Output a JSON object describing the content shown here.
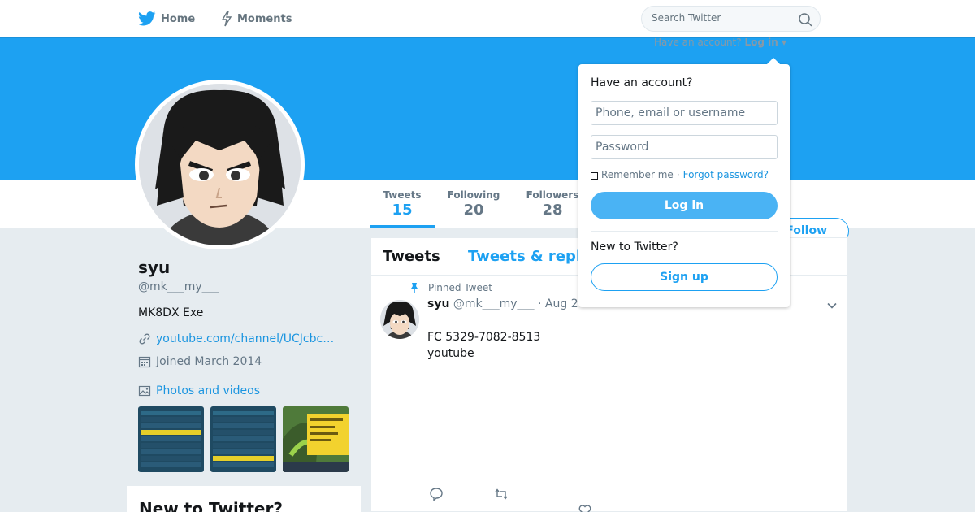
{
  "nav": {
    "home_label": "Home",
    "moments_label": "Moments",
    "search_placeholder": "Search Twitter"
  },
  "login_prompt": {
    "question": "Have an account?",
    "login_link": "Log in"
  },
  "profile": {
    "name": "syu",
    "handle": "@mk___my___",
    "bio": "MK8DX Exe",
    "url": "youtube.com/channel/UCJcbc…",
    "joined": "Joined March 2014",
    "photos_label": "Photos and videos"
  },
  "stats": {
    "tweets_label": "Tweets",
    "tweets_count": "15",
    "following_label": "Following",
    "following_count": "20",
    "followers_label": "Followers",
    "followers_count": "28"
  },
  "follow_button": "Follow",
  "timeline": {
    "tab_tweets": "Tweets",
    "tab_replies": "Tweets & repl",
    "pinned_label": "Pinned Tweet",
    "tweet": {
      "name": "syu",
      "handle_date": "@mk___my___ · Aug 2",
      "line1": "FC 5329-7082-8513",
      "line2": "youtube"
    }
  },
  "new_to_twitter_card": {
    "title": "New to Twitter?"
  },
  "login_dropdown": {
    "title": "Have an account?",
    "username_placeholder": "Phone, email or username",
    "password_placeholder": "Password",
    "remember_label": "Remember me",
    "separator": "·",
    "forgot_label": "Forgot password?",
    "login_button": "Log in",
    "new_label": "New to Twitter?",
    "signup_button": "Sign up"
  },
  "colors": {
    "brand_blue": "#1da1f2",
    "link_blue": "#1b95e0",
    "login_button_blue": "#4ab3f4"
  },
  "icons": [
    "twitter-bird-icon",
    "lightning-icon",
    "search-icon",
    "link-icon",
    "calendar-icon",
    "image-icon",
    "pin-icon",
    "chevron-down-icon",
    "reply-icon",
    "retweet-icon",
    "heart-icon"
  ]
}
